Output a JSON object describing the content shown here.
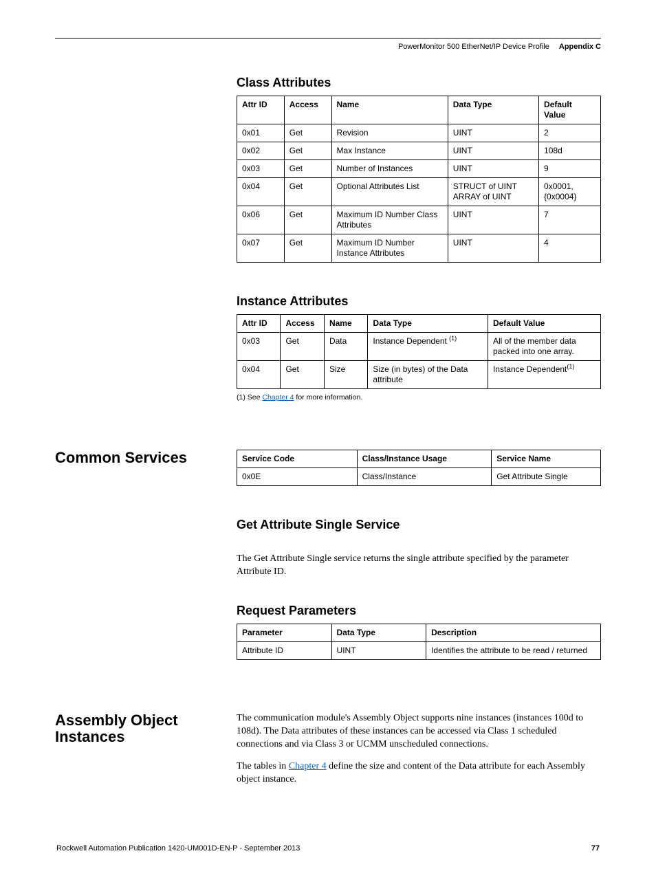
{
  "header": {
    "doc_title": "PowerMonitor 500 EtherNet/IP Device Profile",
    "chapter_label": "Appendix C"
  },
  "sections": {
    "class_attributes": {
      "heading": "Class Attributes",
      "table": {
        "headers": [
          "Attr ID",
          "Access",
          "Name",
          "Data Type",
          "Default Value"
        ],
        "rows": [
          [
            "0x01",
            "Get",
            "Revision",
            "UINT",
            "2"
          ],
          [
            "0x02",
            "Get",
            "Max Instance",
            "UINT",
            "108d"
          ],
          [
            "0x03",
            "Get",
            "Number of Instances",
            "UINT",
            "9"
          ],
          [
            "0x04",
            "Get",
            "Optional Attributes List",
            "STRUCT of UINT ARRAY of UINT",
            "0x0001, {0x0004}"
          ],
          [
            "0x06",
            "Get",
            "Maximum ID Number Class Attributes",
            "UINT",
            "7"
          ],
          [
            "0x07",
            "Get",
            "Maximum ID Number Instance Attributes",
            "UINT",
            "4"
          ]
        ]
      }
    },
    "instance_attributes": {
      "heading": "Instance Attributes",
      "table": {
        "headers": [
          "Attr ID",
          "Access",
          "Name",
          "Data Type",
          "Default Value"
        ],
        "rows": [
          [
            "0x03",
            "Get",
            "Data",
            "Instance Dependent (1)",
            "All of the member data packed into one array."
          ],
          [
            "0x04",
            "Get",
            "Size",
            "Size (in bytes) of the Data attribute",
            "Instance Dependent(1)"
          ]
        ]
      },
      "footnote_prefix": "(1)   See ",
      "footnote_link": "Chapter 4",
      "footnote_suffix": " for more information."
    },
    "common_services": {
      "heading": "Common Services",
      "table": {
        "headers": [
          "Service Code",
          "Class/Instance Usage",
          "Service Name"
        ],
        "rows": [
          [
            "0x0E",
            "Class/Instance",
            "Get Attribute Single"
          ]
        ]
      }
    },
    "get_attr_single": {
      "heading": "Get Attribute Single Service",
      "body": "The Get Attribute Single service returns the single attribute specified by the parameter Attribute ID."
    },
    "request_params": {
      "heading": "Request Parameters",
      "table": {
        "headers": [
          "Parameter",
          "Data Type",
          "Description"
        ],
        "rows": [
          [
            "Attribute ID",
            "UINT",
            "Identifies the attribute to be read / returned"
          ]
        ]
      }
    },
    "assembly_instances": {
      "heading": "Assembly Object Instances",
      "body1": "The communication module's Assembly Object supports nine instances (instances 100d to 108d). The Data attributes of these instances can be accessed via Class 1 scheduled connections and via Class 3 or UCMM unscheduled connections.",
      "body2_prefix": "The tables in ",
      "body2_link": "Chapter 4",
      "body2_suffix": " define the size and content of the Data attribute for each Assembly object instance."
    }
  },
  "footer": {
    "pub": "Rockwell Automation Publication 1420-UM001D-EN-P - September 2013",
    "page": "77"
  }
}
